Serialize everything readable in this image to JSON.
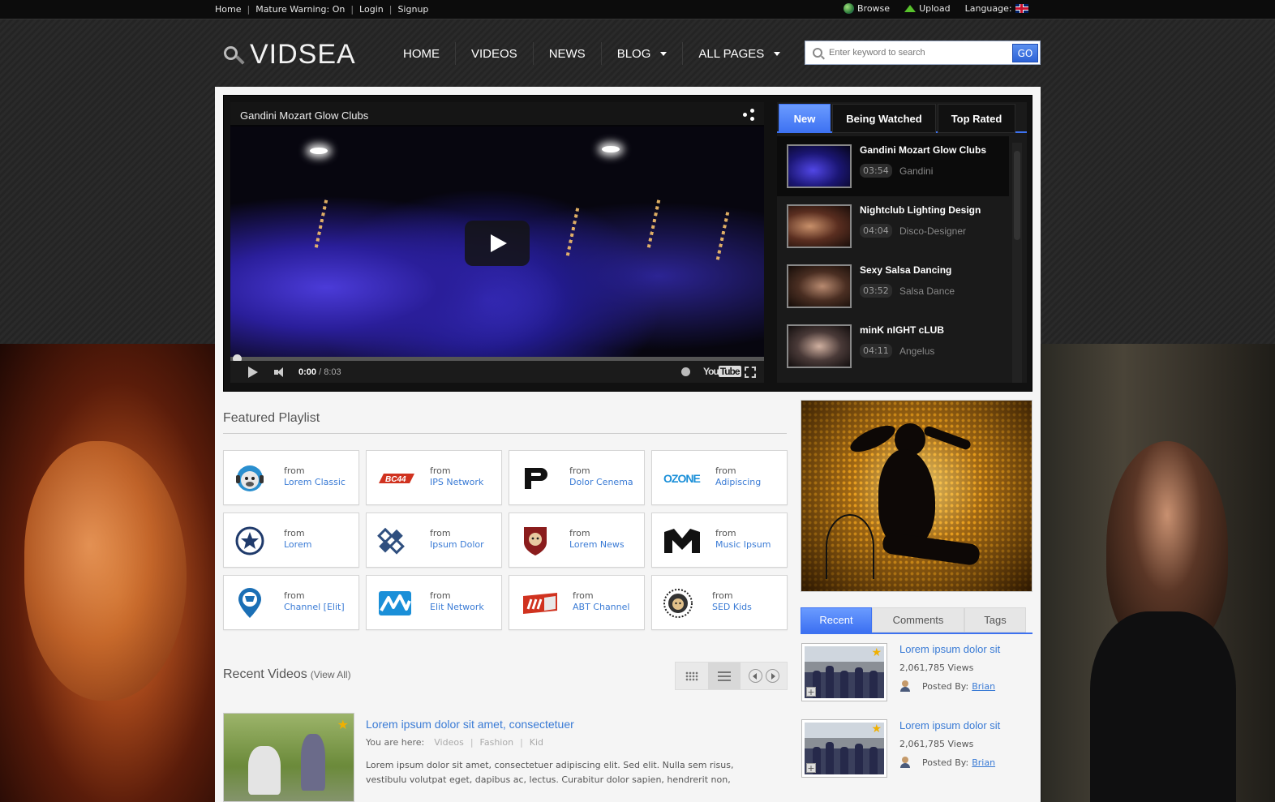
{
  "topbar": {
    "links": [
      "Home",
      "Mature Warning: On",
      "Login",
      "Signup"
    ],
    "browse": "Browse",
    "upload": "Upload",
    "language": "Language:"
  },
  "logo": "VIDSEA",
  "nav": [
    {
      "label": "HOME",
      "dropdown": false
    },
    {
      "label": "VIDEOS",
      "dropdown": false
    },
    {
      "label": "NEWS",
      "dropdown": false
    },
    {
      "label": "BLOG",
      "dropdown": true
    },
    {
      "label": "ALL PAGES",
      "dropdown": true
    }
  ],
  "search": {
    "placeholder": "Enter keyword to search",
    "button": "GO"
  },
  "player": {
    "title": "Gandini Mozart Glow Clubs",
    "current_time": "0:00",
    "duration": "/ 8:03",
    "brand": "You",
    "brand_box": "Tube"
  },
  "video_tabs": [
    {
      "label": "New",
      "active": true
    },
    {
      "label": "Being Watched",
      "active": false
    },
    {
      "label": "Top Rated",
      "active": false
    }
  ],
  "video_list": [
    {
      "title": "Gandini Mozart Glow Clubs",
      "duration": "03:54",
      "author": "Gandini",
      "active": true
    },
    {
      "title": "Nightclub Lighting Design",
      "duration": "04:04",
      "author": "Disco-Designer",
      "active": false
    },
    {
      "title": "Sexy Salsa Dancing",
      "duration": "03:52",
      "author": "Salsa Dance",
      "active": false
    },
    {
      "title": "minK nIGHT cLUB",
      "duration": "04:11",
      "author": "Angelus",
      "active": false
    }
  ],
  "featured": {
    "title": "Featured Playlist",
    "from_label": "from",
    "channels": [
      {
        "name": "Lorem Classic",
        "logo": "monkey-headphones-logo",
        "color": "#2a8fcf"
      },
      {
        "name": "IPS Network",
        "logo": "bc44-logo",
        "color": "#d0321f"
      },
      {
        "name": "Dolor Cenema",
        "logo": "p-logo",
        "color": "#111111"
      },
      {
        "name": "Adipiscing",
        "logo": "ozone-logo",
        "color": "#1a8fd8"
      },
      {
        "name": "Lorem",
        "logo": "star-badge-logo",
        "color": "#1f3a6b"
      },
      {
        "name": "Ipsum Dolor",
        "logo": "diamond-logo",
        "color": "#2f4f7f"
      },
      {
        "name": "Lorem News",
        "logo": "lion-shield-logo",
        "color": "#8a1c1c"
      },
      {
        "name": "Music Ipsum",
        "logo": "m-logo",
        "color": "#111111"
      },
      {
        "name": "Channel [Elit]",
        "logo": "cart-pin-logo",
        "color": "#1b6fb5"
      },
      {
        "name": "Elit Network",
        "logo": "wave-logo",
        "color": "#1a8fd8"
      },
      {
        "name": "ABT Channel",
        "logo": "abt-logo",
        "color": "#d0321f"
      },
      {
        "name": "SED Kids",
        "logo": "lion-circle-logo",
        "color": "#222222"
      }
    ]
  },
  "recent": {
    "title": "Recent Videos",
    "view_all": "(View All)",
    "item": {
      "title": "Lorem ipsum dolor sit amet, consectetuer",
      "you_are_here": "You are here:",
      "crumbs": [
        "Videos",
        "Fashion",
        "Kid"
      ],
      "desc": "Lorem ipsum dolor sit amet, consectetuer adipiscing elit. Sed elit. Nulla sem risus, vestibulu volutpat eget, dapibus ac, lectus. Curabitur dolor sapien, hendrerit non,"
    }
  },
  "side_tabs": [
    {
      "label": "Recent",
      "active": true
    },
    {
      "label": "Comments",
      "active": false
    },
    {
      "label": "Tags",
      "active": false
    }
  ],
  "side_items": [
    {
      "title": "Lorem ipsum dolor sit",
      "views": "2,061,785 Views",
      "posted_by": "Posted By:",
      "author": "Brian"
    },
    {
      "title": "Lorem ipsum dolor sit",
      "views": "2,061,785 Views",
      "posted_by": "Posted By:",
      "author": "Brian"
    }
  ]
}
